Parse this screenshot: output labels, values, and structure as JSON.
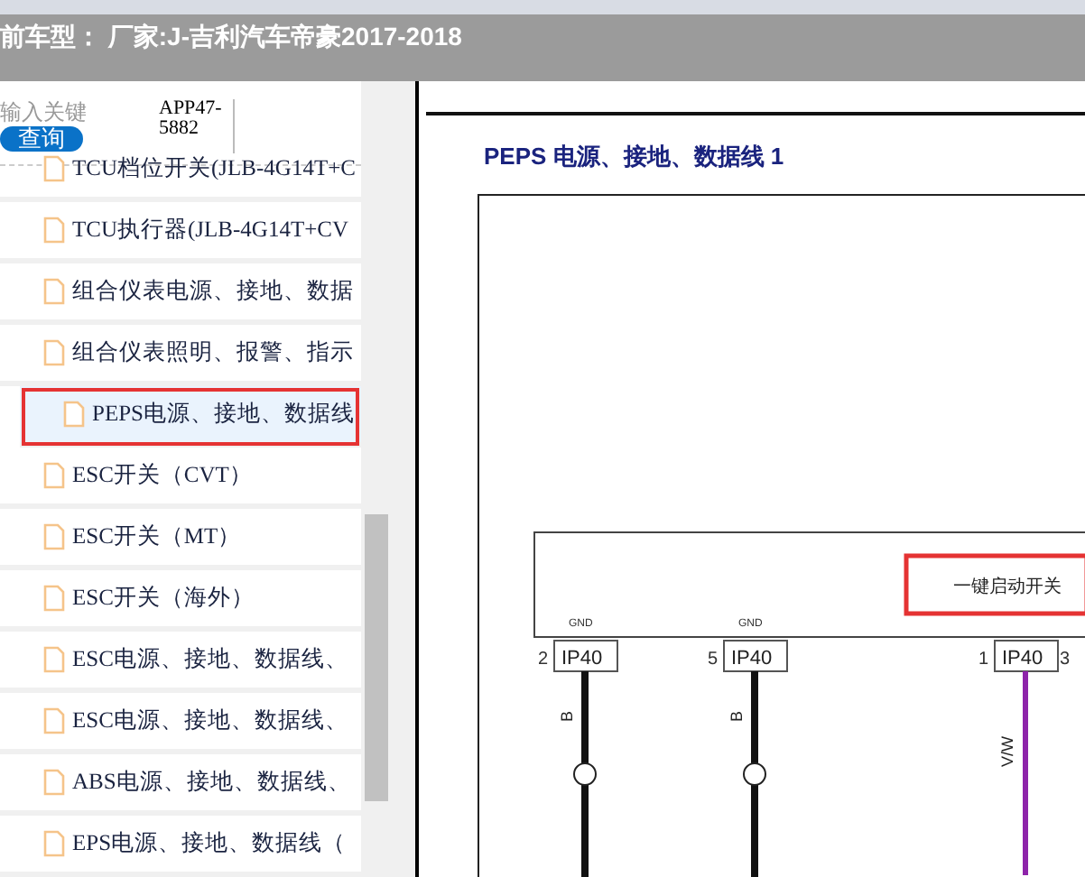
{
  "header": {
    "title": "前车型： 厂家:J-吉利汽车帝豪2017-2018"
  },
  "search": {
    "placeholder": "输入关键",
    "code": "APP47-5882",
    "button": "查询"
  },
  "items": [
    {
      "label": "TCU档位开关(JLB-4G14T+C",
      "selected": false
    },
    {
      "label": "TCU执行器(JLB-4G14T+CV",
      "selected": false
    },
    {
      "label": "组合仪表电源、接地、数据",
      "selected": false
    },
    {
      "label": "组合仪表照明、报警、指示",
      "selected": false
    },
    {
      "label": "PEPS电源、接地、数据线",
      "selected": true
    },
    {
      "label": "ESC开关（CVT）",
      "selected": false
    },
    {
      "label": "ESC开关（MT）",
      "selected": false
    },
    {
      "label": "ESC开关（海外）",
      "selected": false
    },
    {
      "label": "ESC电源、接地、数据线、",
      "selected": false
    },
    {
      "label": "ESC电源、接地、数据线、",
      "selected": false
    },
    {
      "label": "ABS电源、接地、数据线、",
      "selected": false
    },
    {
      "label": "EPS电源、接地、数据线（",
      "selected": false
    }
  ],
  "diagram": {
    "heading": "PEPS 电源、接地、数据线 1",
    "component": "一键启动开关",
    "pins": [
      {
        "number": "2",
        "connector": "IP40",
        "signal": "GND",
        "wire": "B"
      },
      {
        "number": "5",
        "connector": "IP40",
        "signal": "GND",
        "wire": "B"
      },
      {
        "number": "1",
        "connector": "IP40",
        "wire": "V/W"
      },
      {
        "number": "3"
      }
    ]
  }
}
